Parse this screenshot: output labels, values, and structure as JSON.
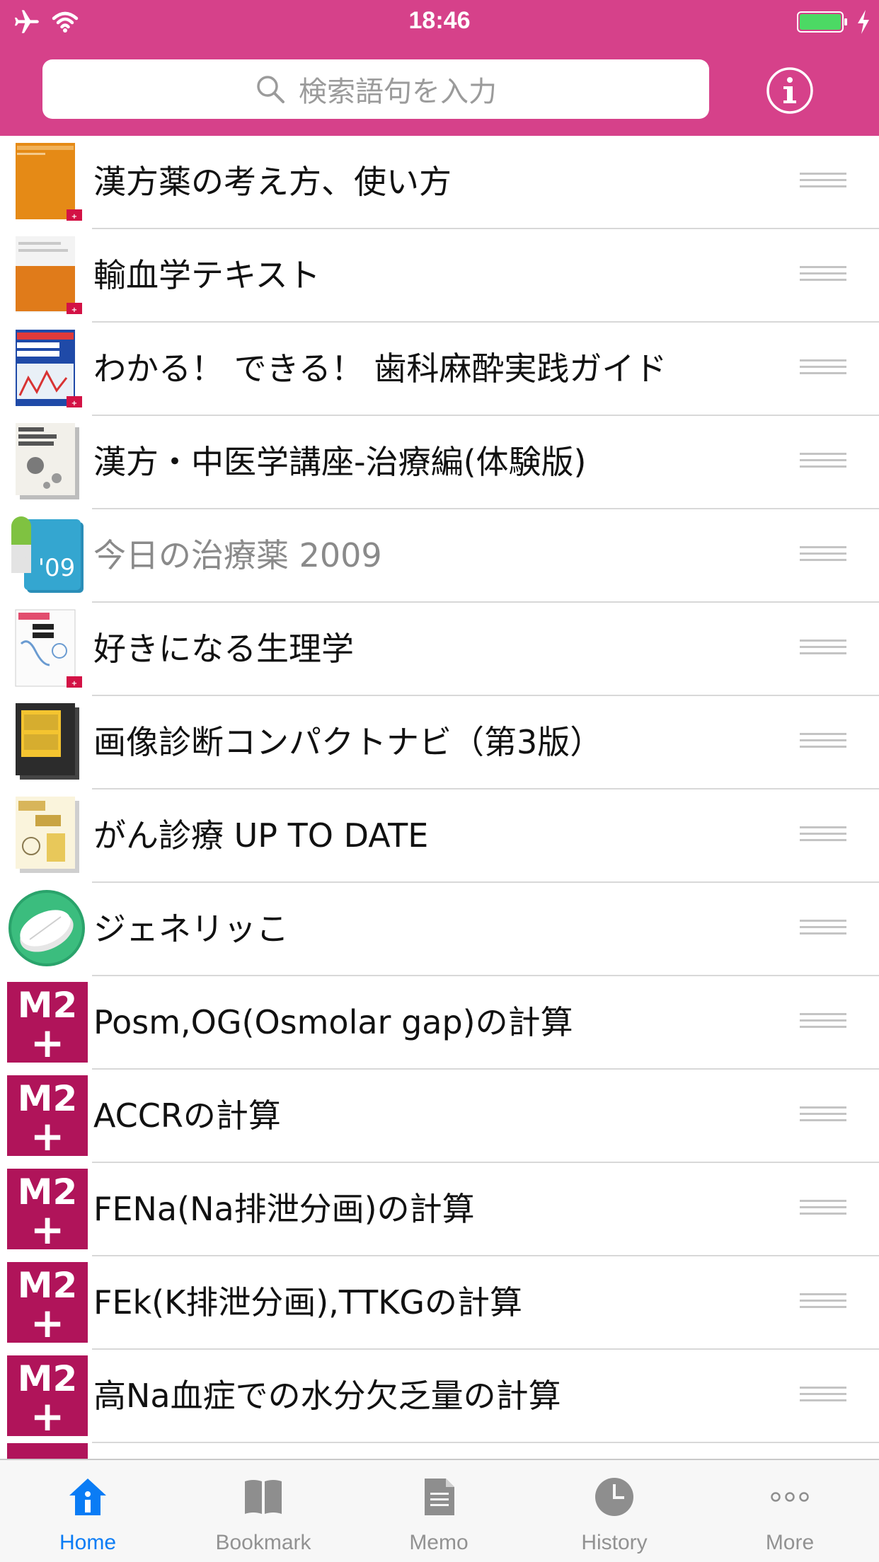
{
  "status_bar": {
    "time": "18:46"
  },
  "search": {
    "placeholder": "検索語句を入力"
  },
  "list": {
    "items": [
      {
        "title": "漢方薬の考え方、使い方",
        "icon": "book-cover-orange",
        "dimmed": false
      },
      {
        "title": "輸血学テキスト",
        "icon": "book-cover-transfusion",
        "dimmed": false
      },
      {
        "title": "わかる！ できる！ 歯科麻酔実践ガイド",
        "icon": "book-cover-dental",
        "dimmed": false
      },
      {
        "title": "漢方・中医学講座-治療編(体験版)",
        "icon": "book-cover-kampo",
        "dimmed": false
      },
      {
        "title": "今日の治療薬 2009",
        "icon": "book-cover-09",
        "dimmed": true
      },
      {
        "title": "好きになる生理学",
        "icon": "book-cover-physiology",
        "dimmed": false
      },
      {
        "title": "画像診断コンパクトナビ（第3版）",
        "icon": "book-cover-imaging",
        "dimmed": false
      },
      {
        "title": "がん診療 UP TO DATE",
        "icon": "book-cover-cancer",
        "dimmed": false
      },
      {
        "title": "ジェネリッこ",
        "icon": "pill-icon",
        "dimmed": false
      },
      {
        "title": "Posm,OG(Osmolar gap)の計算",
        "icon": "m2-plus-icon",
        "dimmed": false
      },
      {
        "title": "ACCRの計算",
        "icon": "m2-plus-icon",
        "dimmed": false
      },
      {
        "title": "FENa(Na排泄分画)の計算",
        "icon": "m2-plus-icon",
        "dimmed": false
      },
      {
        "title": "FEk(K排泄分画),TTKGの計算",
        "icon": "m2-plus-icon",
        "dimmed": false
      },
      {
        "title": "高Na血症での水分欠乏量の計算",
        "icon": "m2-plus-icon",
        "dimmed": false
      }
    ]
  },
  "m2_logo": {
    "line1": "M2",
    "line2": "+"
  },
  "cover_09": "'09",
  "tabbar": {
    "tabs": [
      {
        "label": "Home",
        "icon": "home-icon",
        "active": true
      },
      {
        "label": "Bookmark",
        "icon": "book-icon",
        "active": false
      },
      {
        "label": "Memo",
        "icon": "memo-icon",
        "active": false
      },
      {
        "label": "History",
        "icon": "clock-icon",
        "active": false
      },
      {
        "label": "More",
        "icon": "more-icon",
        "active": false
      }
    ]
  },
  "colors": {
    "header": "#d6418a",
    "m2": "#b0145a",
    "active_tab": "#0a7cf5"
  }
}
